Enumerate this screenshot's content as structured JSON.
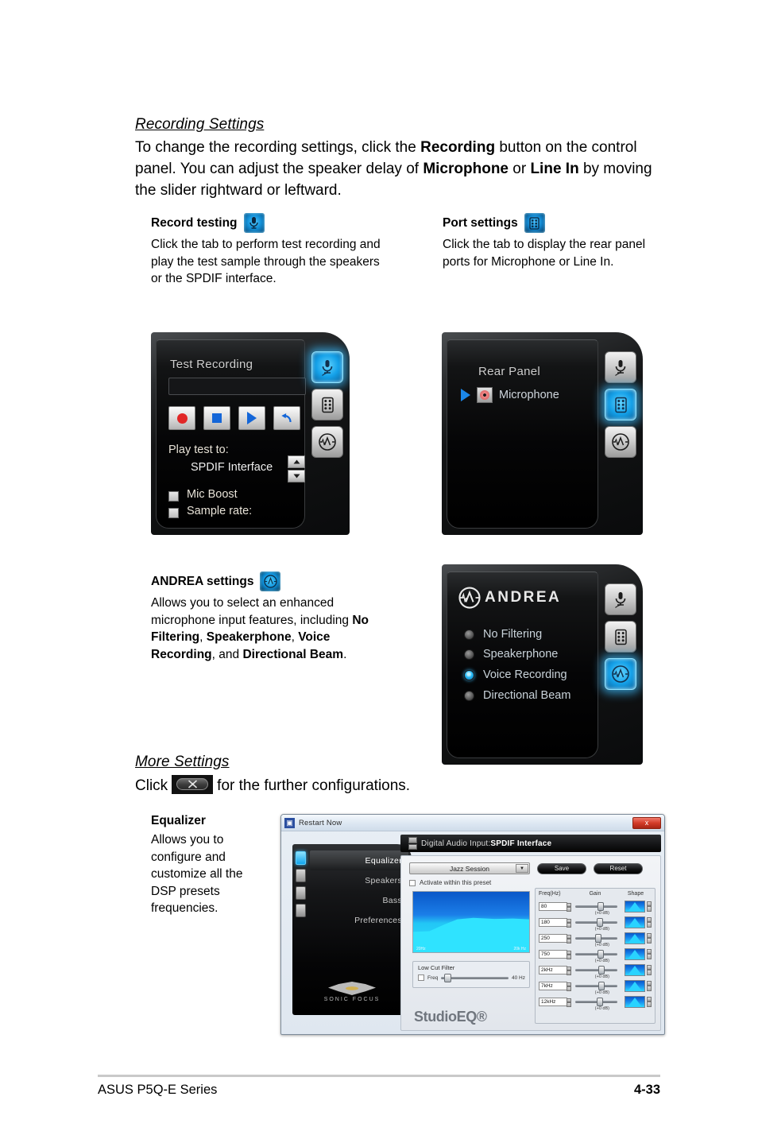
{
  "sections": {
    "recording_settings": {
      "heading": "Recording Settings",
      "body_1": "To change the recording settings, click the ",
      "body_b1": "Recording",
      "body_2": " button on the control panel. You can adjust the speaker delay of ",
      "body_b2": "Microphone",
      "body_3": " or ",
      "body_b3": "Line In",
      "body_4": " by moving the slider rightward or leftward."
    },
    "record_testing": {
      "heading": "Record testing",
      "icon": "microphone-icon",
      "body": "Click the tab to perform test recording and play the test sample through the speakers or the SPDIF interface."
    },
    "port_settings": {
      "heading": "Port settings",
      "icon": "ports-grid-icon",
      "body": "Click the tab to display the rear panel ports for Microphone or Line In."
    },
    "andrea_settings": {
      "heading": "ANDREA settings",
      "icon": "andrea-icon",
      "body_1": "Allows you to select an enhanced microphone input features, including ",
      "body_b1": "No Filtering",
      "body_2": ", ",
      "body_b2": "Speakerphone",
      "body_3": ", ",
      "body_b3": "Voice Recording",
      "body_4": ", and ",
      "body_b4": "Directional Beam",
      "body_5": "."
    },
    "more_settings": {
      "heading": "More Settings",
      "click_label": "Click",
      "after_label": "for the further configurations."
    },
    "equalizer": {
      "heading": "Equalizer",
      "body": "Allows you to configure and customize all the DSP presets frequencies."
    }
  },
  "test_recording_panel": {
    "title": "Test Recording",
    "buttons": [
      {
        "name": "record-button",
        "glyph": "record-dot"
      },
      {
        "name": "stop-button",
        "glyph": "stop-square"
      },
      {
        "name": "play-button",
        "glyph": "play-triangle"
      },
      {
        "name": "reset-button",
        "glyph": "undo-arrow"
      }
    ],
    "play_test_label": "Play test to:",
    "play_test_value": "SPDIF Interface",
    "mic_boost_label": "Mic Boost",
    "sample_rate_label": "Sample rate:",
    "tabs": [
      {
        "name": "tab-record-testing",
        "icon": "microphone-icon",
        "active": true
      },
      {
        "name": "tab-port-settings",
        "icon": "ports-grid-icon",
        "active": false
      },
      {
        "name": "tab-andrea",
        "icon": "andrea-icon",
        "active": false
      }
    ]
  },
  "rear_panel_panel": {
    "title": "Rear Panel",
    "port_label": "Microphone",
    "tabs": [
      {
        "name": "tab-record-testing",
        "icon": "microphone-icon",
        "active": false
      },
      {
        "name": "tab-port-settings",
        "icon": "ports-grid-icon",
        "active": true
      },
      {
        "name": "tab-andrea",
        "icon": "andrea-icon",
        "active": false
      }
    ]
  },
  "andrea_panel": {
    "brand": "ANDREA",
    "options": [
      {
        "label": "No Filtering",
        "selected": false
      },
      {
        "label": "Speakerphone",
        "selected": false
      },
      {
        "label": "Voice Recording",
        "selected": true
      },
      {
        "label": "Directional Beam",
        "selected": false
      }
    ],
    "tabs": [
      {
        "name": "tab-record-testing",
        "icon": "microphone-icon",
        "active": false
      },
      {
        "name": "tab-port-settings",
        "icon": "ports-grid-icon",
        "active": false
      },
      {
        "name": "tab-andrea",
        "icon": "andrea-icon",
        "active": true
      }
    ]
  },
  "studio_eq_window": {
    "title": "Restart Now",
    "close_label": "x",
    "nav": [
      {
        "label": "Equalizer",
        "active": true
      },
      {
        "label": "Speakers",
        "active": false
      },
      {
        "label": "Bass",
        "active": false
      },
      {
        "label": "Preferences",
        "active": false
      }
    ],
    "brand_footer": "SONIC FOCUS",
    "input_header_prefix": "Digital Audio Input:",
    "input_header_value": "SPDIF Interface",
    "preset": "Jazz Session",
    "save_label": "Save",
    "reset_label": "Reset",
    "activate_label": "Activate within this preset",
    "graph_left_label": "20Hz",
    "graph_right_label": "20k Hz",
    "low_cut_title": "Low Cut Filter",
    "low_cut_freq_label": "Freq",
    "low_cut_value": "40 Hz",
    "product_name": "StudioEQ",
    "product_mark": "®",
    "bands_headers": [
      "Freq(Hz)",
      "Gain",
      "Shape"
    ],
    "bands": [
      {
        "freq": "80",
        "gain": "(+0 dB)",
        "knob": 52
      },
      {
        "freq": "180",
        "gain": "(+0 dB)",
        "knob": 50
      },
      {
        "freq": "250",
        "gain": "(+0 dB)",
        "knob": 47
      },
      {
        "freq": "750",
        "gain": "(+0 dB)",
        "knob": 52
      },
      {
        "freq": "2kHz",
        "gain": "(+0 dB)",
        "knob": 55
      },
      {
        "freq": "7kHz",
        "gain": "(+0 dB)",
        "knob": 54
      },
      {
        "freq": "12kHz",
        "gain": "(+0 dB)",
        "knob": 50
      }
    ]
  },
  "footer": {
    "left": "ASUS P5Q-E Series",
    "right": "4-33"
  }
}
